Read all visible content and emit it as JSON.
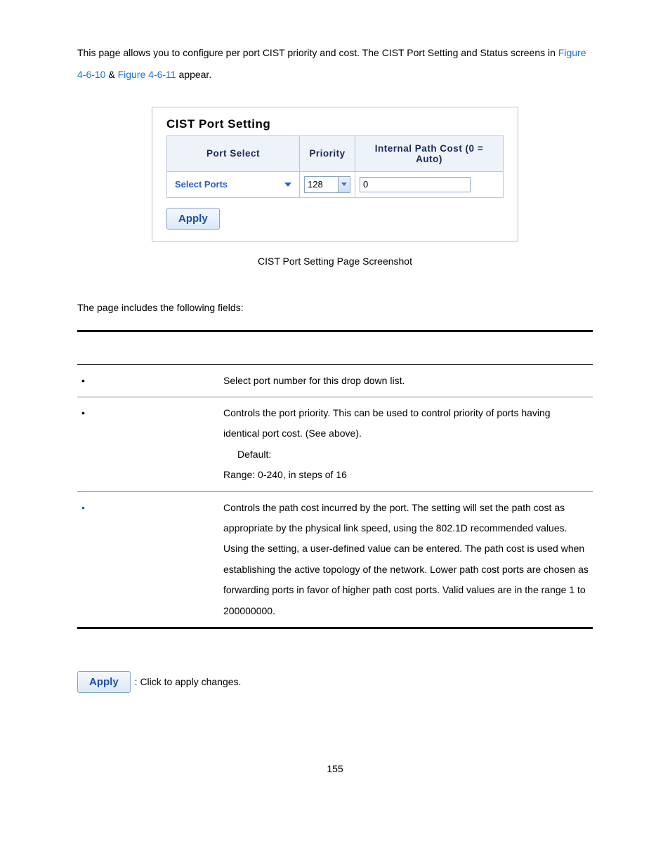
{
  "intro": {
    "part1": "This page allows you to configure per port CIST priority and cost. The CIST Port Setting and Status screens in ",
    "link1": "Figure 4-6-10",
    "amp": " & ",
    "link2": "Figure 4-6-11",
    "part2": " appear."
  },
  "panel": {
    "title": "CIST Port Setting",
    "headers": {
      "port_select": "Port Select",
      "priority": "Priority",
      "internal_path_cost": "Internal Path Cost (0 = Auto)"
    },
    "fields": {
      "port_select_label": "Select Ports",
      "priority_value": "128",
      "ipc_value": "0"
    },
    "apply": "Apply"
  },
  "caption": "CIST Port Setting Page Screenshot",
  "subhead": "The page includes the following fields:",
  "fields_table": {
    "rows": [
      {
        "desc": "Select port number for this drop down list."
      },
      {
        "desc_p1": "Controls the port priority. This can be used to control priority of ports having identical port cost. (See above).",
        "default_label": "Default:",
        "range": "Range: 0-240, in steps of 16"
      },
      {
        "desc_p1": "Controls the path cost incurred by the port. The ",
        "desc_p2": " setting will set the path cost as appropriate by the physical link speed, using the 802.1D recommended values. Using the ",
        "desc_p3": " setting, a user-defined value can be entered. The path cost is used when establishing the active topology of the network. Lower path cost ports are chosen as forwarding ports in favor of higher path cost ports. Valid values are in the range 1 to 200000000."
      }
    ]
  },
  "buttons": {
    "apply_label": "Apply",
    "apply_desc": ": Click to apply changes."
  },
  "page_number": "155"
}
